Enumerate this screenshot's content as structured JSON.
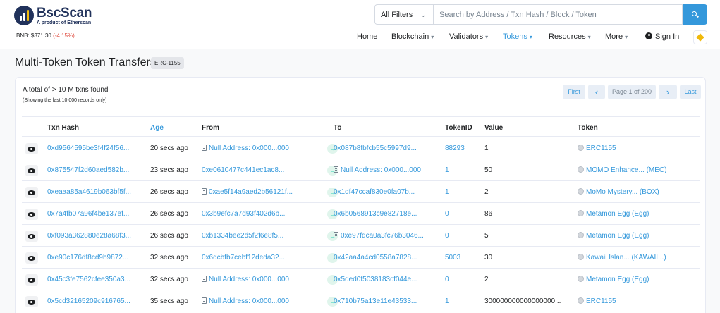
{
  "brand": {
    "name": "BscScan",
    "tagline": "A product of Etherscan"
  },
  "price": {
    "label": "BNB: ",
    "value": "$371.30",
    "change": "(-4.15%)"
  },
  "search": {
    "filter": "All Filters",
    "placeholder": "Search by Address / Txn Hash / Block / Token"
  },
  "nav": {
    "home": "Home",
    "blockchain": "Blockchain",
    "validators": "Validators",
    "tokens": "Tokens",
    "resources": "Resources",
    "more": "More",
    "signin": "Sign In"
  },
  "page": {
    "title": "Multi-Token Token Transfers",
    "badge": "ERC-1155"
  },
  "summary": {
    "total": "A total of > 10 M txns found",
    "note": "(Showing the last 10,000 records only)"
  },
  "pagination": {
    "first": "First",
    "prev": "‹",
    "info": "Page 1 of 200",
    "next": "›",
    "last": "Last"
  },
  "columns": {
    "txn_hash": "Txn Hash",
    "age": "Age",
    "from": "From",
    "to": "To",
    "token_id": "TokenID",
    "value": "Value",
    "token": "Token"
  },
  "rows": [
    {
      "hash": "0xd9564595be3f4f24f56...",
      "age": "20 secs ago",
      "from": "Null Address: 0x000...000",
      "from_doc": true,
      "to": "0x087b8fbfcb55c5997d9...",
      "to_doc": false,
      "token_id": "88293",
      "value": "1",
      "token": "ERC1155"
    },
    {
      "hash": "0x875547f2d60aed582b...",
      "age": "23 secs ago",
      "from": "0xe0610477c441ec1ac8...",
      "from_doc": false,
      "to": "Null Address: 0x000...000",
      "to_doc": true,
      "token_id": "1",
      "value": "50",
      "token": "MOMO Enhance... (MEC)"
    },
    {
      "hash": "0xeaaa85a4619b063bf5f...",
      "age": "26 secs ago",
      "from": "0xae5f14a9aed2b56121f...",
      "from_doc": true,
      "to": "0x1df47ccaf830e0fa07b...",
      "to_doc": false,
      "token_id": "1",
      "value": "2",
      "token": "MoMo Mystery... (BOX)"
    },
    {
      "hash": "0x7a4fb07a96f4be137ef...",
      "age": "26 secs ago",
      "from": "0x3b9efc7a7d93f402d6b...",
      "from_doc": false,
      "to": "0x6b0568913c9e82718e...",
      "to_doc": false,
      "token_id": "0",
      "value": "86",
      "token": "Metamon Egg (Egg)"
    },
    {
      "hash": "0xf093a362880e28a68f3...",
      "age": "26 secs ago",
      "from": "0xb1334bee2d5f2f6e8f5...",
      "from_doc": false,
      "to": "0xe97fdca0a3fc76b3046...",
      "to_doc": true,
      "token_id": "0",
      "value": "5",
      "token": "Metamon Egg (Egg)"
    },
    {
      "hash": "0xe90c176df8cd9b9872...",
      "age": "32 secs ago",
      "from": "0x6dcbfb7cebf12deda32...",
      "from_doc": false,
      "to": "0x42aa4a4cd0558a7828...",
      "to_doc": false,
      "token_id": "5003",
      "value": "30",
      "token": "Kawaii Islan... (KAWAII...)"
    },
    {
      "hash": "0x45c3fe7562cfee350a3...",
      "age": "32 secs ago",
      "from": "Null Address: 0x000...000",
      "from_doc": true,
      "to": "0x5ded0f5038183cf044e...",
      "to_doc": false,
      "token_id": "0",
      "value": "2",
      "token": "Metamon Egg (Egg)"
    },
    {
      "hash": "0x5cd32165209c916765...",
      "age": "35 secs ago",
      "from": "Null Address: 0x000...000",
      "from_doc": true,
      "to": "0x710b75a13e11e43533...",
      "to_doc": false,
      "token_id": "1",
      "value": "300000000000000000...",
      "token": "ERC1155"
    }
  ]
}
